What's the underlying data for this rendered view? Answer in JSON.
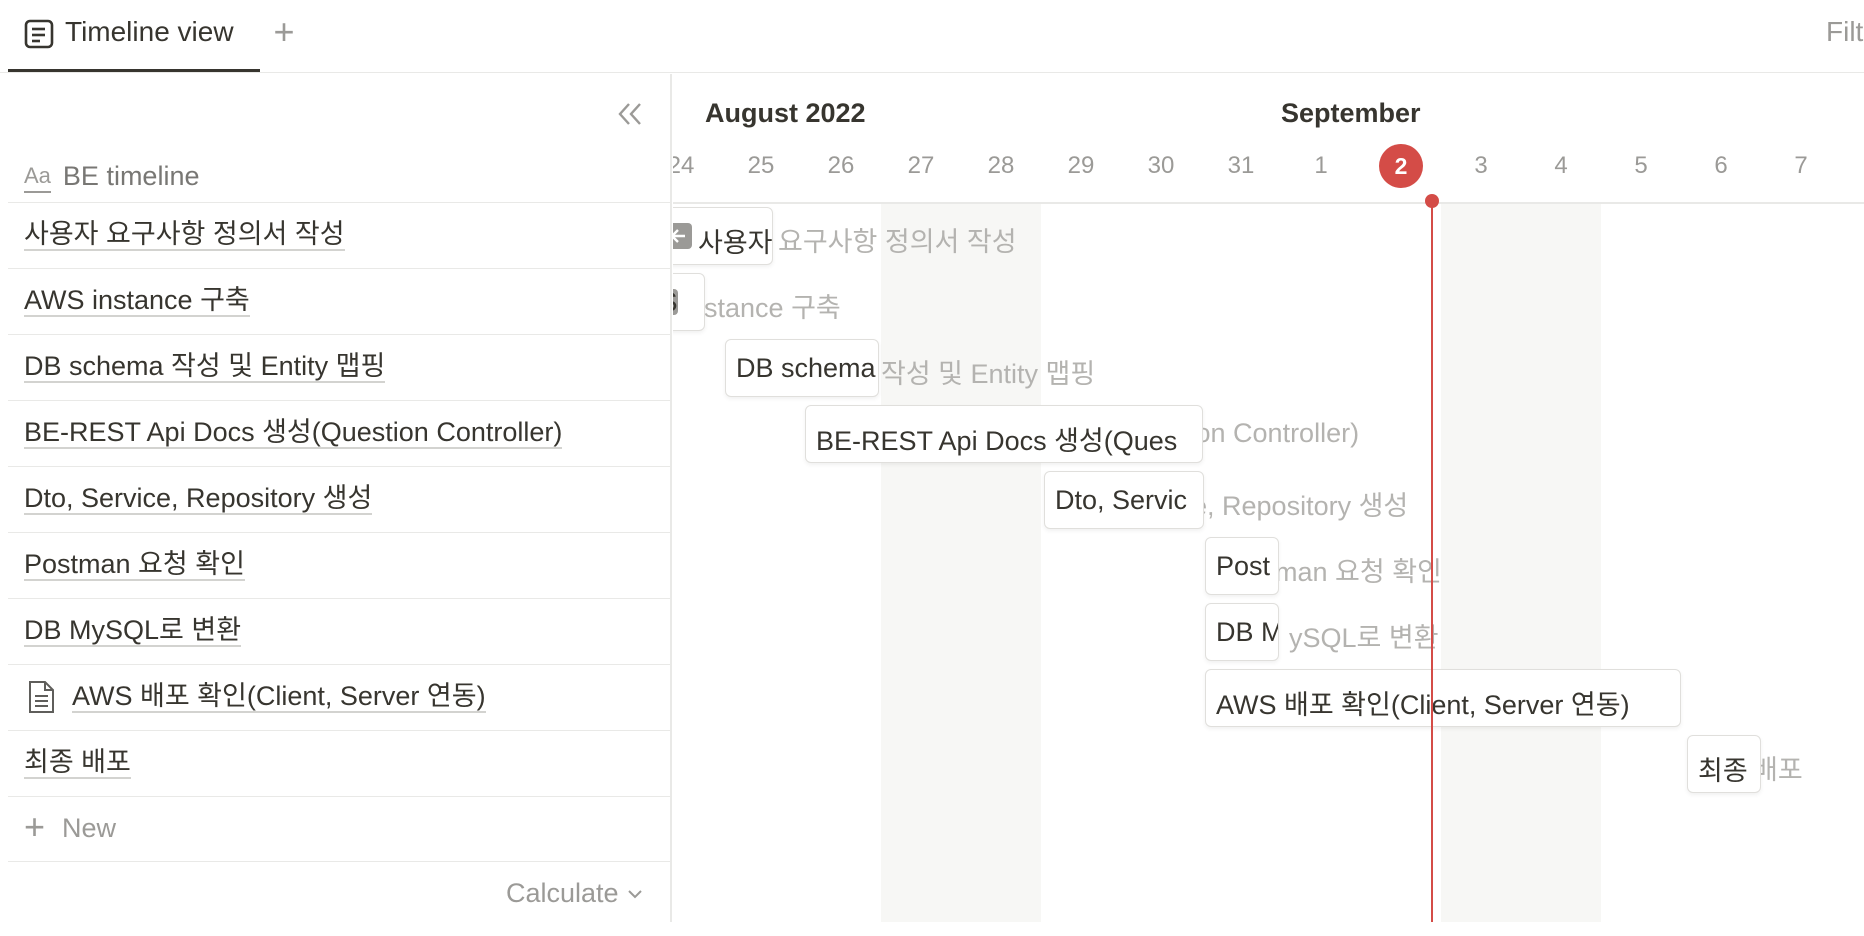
{
  "tabs": {
    "active_label": "Timeline view",
    "add_label": "+",
    "filter_label": "Filt"
  },
  "table": {
    "property_icon": "Aa",
    "property_label": "BE timeline",
    "rows": [
      {
        "title": "사용자 요구사항 정의서 작성",
        "has_doc_icon": false
      },
      {
        "title": "AWS instance 구축",
        "has_doc_icon": false
      },
      {
        "title": "DB schema 작성 및 Entity 맵핑",
        "has_doc_icon": false
      },
      {
        "title": "BE-REST Api Docs 생성(Question Controller)",
        "has_doc_icon": false
      },
      {
        "title": "Dto, Service, Repository 생성",
        "has_doc_icon": false
      },
      {
        "title": "Postman 요청 확인",
        "has_doc_icon": false
      },
      {
        "title": "DB MySQL로 변환",
        "has_doc_icon": false
      },
      {
        "title": "AWS 배포 확인(Client, Server 연동)",
        "has_doc_icon": true
      },
      {
        "title": "최종 배포",
        "has_doc_icon": false
      }
    ],
    "new_label": "New",
    "calculate_label": "Calculate"
  },
  "timeline": {
    "months": [
      {
        "label": "August 2022",
        "day_index": 0.3
      },
      {
        "label": "September",
        "day_index": 7.5
      }
    ],
    "days": [
      "24",
      "25",
      "26",
      "27",
      "28",
      "29",
      "30",
      "31",
      "1",
      "2",
      "3",
      "4",
      "5",
      "6",
      "7"
    ],
    "today": "2",
    "today_index": 9,
    "weekend_day_indices": [
      3,
      4,
      10,
      11
    ],
    "accent_color": "#d44c47",
    "bars": [
      {
        "row": 0,
        "visible_text": "사용자",
        "ghost_text": "요구사항 정의서 작성",
        "back_arrow": true
      },
      {
        "row": 1,
        "visible_text": "WS",
        "ghost_text": "instance 구축",
        "back_arrow": true
      },
      {
        "row": 2,
        "visible_text": "DB schema",
        "ghost_text": "작성 및 Entity 맵핑",
        "back_arrow": false
      },
      {
        "row": 3,
        "visible_text": "BE-REST Api Docs 생성(Ques",
        "ghost_text": "tion Controller)",
        "back_arrow": false
      },
      {
        "row": 4,
        "visible_text": "Dto, Servic",
        "ghost_text": "e, Repository 생성",
        "back_arrow": false
      },
      {
        "row": 5,
        "visible_text": "Post",
        "ghost_text": "man 요청 확인",
        "back_arrow": false
      },
      {
        "row": 6,
        "visible_text": "DB M",
        "ghost_text": "ySQL로 변환",
        "back_arrow": false
      },
      {
        "row": 7,
        "visible_text": "AWS 배포 확인(Client, Server 연동)",
        "ghost_text": "",
        "back_arrow": false
      },
      {
        "row": 8,
        "visible_text": "최종 ",
        "ghost_text": "배포",
        "back_arrow": false
      }
    ]
  }
}
